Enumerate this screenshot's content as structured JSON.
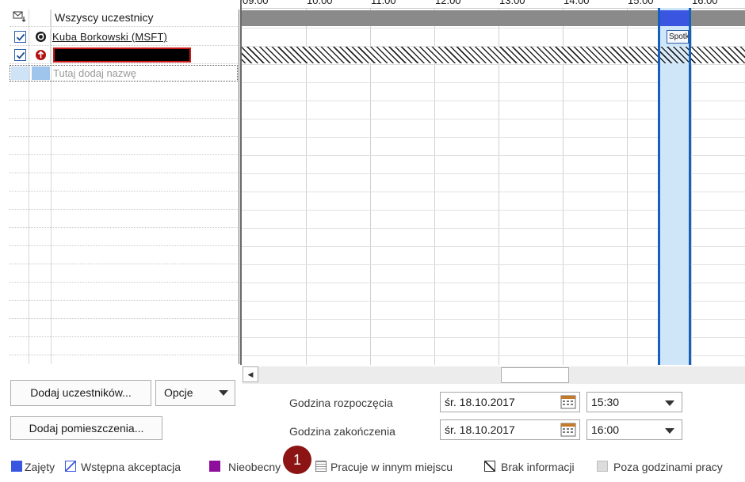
{
  "attendees": {
    "header_label": "Wszyscy uczestnicy",
    "rows": [
      {
        "name": "Kuba Borkowski (MSFT)",
        "checked": true,
        "role": "organizer"
      },
      {
        "name": "",
        "checked": true,
        "role": "required",
        "redacted": true
      }
    ],
    "add_name_placeholder": "Tutaj dodaj nazwę"
  },
  "timeline": {
    "hours": [
      "09:00",
      "10:00",
      "11:00",
      "12:00",
      "13:00",
      "14:00",
      "15:00",
      "16:00"
    ],
    "meeting_label": "Spotkanie"
  },
  "buttons": {
    "add_attendees": "Dodaj uczestników...",
    "options": "Opcje",
    "add_rooms": "Dodaj pomieszczenia..."
  },
  "time_fields": {
    "start_label": "Godzina rozpoczęcia",
    "start_date": "śr. 18.10.2017",
    "start_time": "15:30",
    "end_label": "Godzina zakończenia",
    "end_date": "śr. 18.10.2017",
    "end_time": "16:00"
  },
  "legend": [
    {
      "label": "Zajęty",
      "color": "#3a56e0"
    },
    {
      "label": "Wstępna akceptacja",
      "color": "#3a56e0"
    },
    {
      "label": "Nieobecny",
      "color": "#8e0f9c"
    },
    {
      "label": "Pracuje w innym miejscu",
      "color": "#7a7a7a"
    },
    {
      "label": "Brak informacji",
      "color": "#222222"
    },
    {
      "label": "Poza godzinami pracy",
      "color": "#dcdcdc"
    }
  ],
  "badge": {
    "text": "1"
  },
  "colors": {
    "meeting_border": "#1560bd",
    "meeting_fill": "#cfe5f8",
    "busy_band": "#8a8a8a",
    "badge": "#8c1414"
  }
}
